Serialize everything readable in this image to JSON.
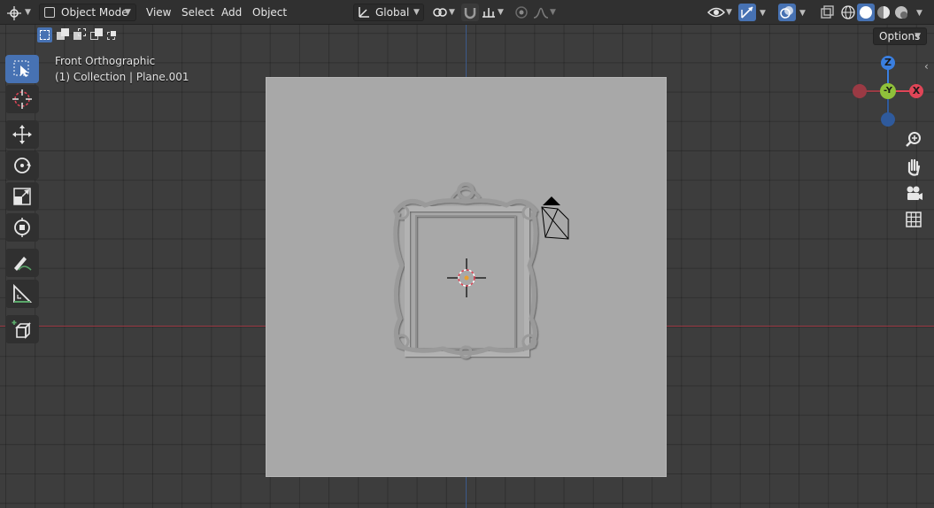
{
  "header": {
    "mode_label": "Object Mode",
    "menus": [
      "View",
      "Select",
      "Add",
      "Object"
    ],
    "transform_orientation": "Global"
  },
  "viewport": {
    "view_name": "Front Orthographic",
    "collection_info": "(1) Collection | Plane.001",
    "options_label": "Options"
  },
  "gizmo": {
    "z_label": "Z",
    "y_label": "-Y",
    "x_label": "X"
  },
  "colors": {
    "active_tool": "#4772b3",
    "x_axis": "#e04557",
    "y_axis": "#8fc03a",
    "z_axis": "#3a7fe0"
  },
  "tools": [
    "select-box-icon",
    "cursor-icon",
    "move-icon",
    "rotate-icon",
    "scale-icon",
    "transform-icon",
    "annotate-icon",
    "measure-icon",
    "add-cube-icon"
  ]
}
